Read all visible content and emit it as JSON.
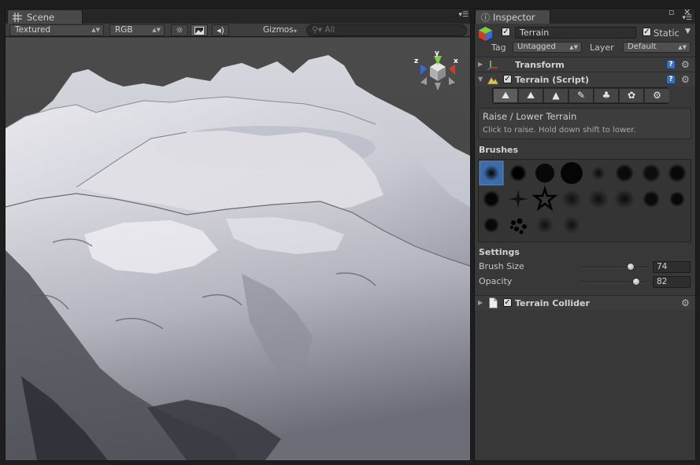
{
  "scene": {
    "tab_label": "Scene",
    "render_mode": "Textured",
    "color_mode": "RGB",
    "lighting_icon": "sun-icon",
    "image_icon": "image-icon",
    "audio_icon": "speaker-icon",
    "gizmos_label": "Gizmos",
    "search_placeholder": "All",
    "axis_labels": {
      "y": "y",
      "x": "x",
      "z": "z"
    }
  },
  "inspector": {
    "tab_label": "Inspector",
    "object_name": "Terrain",
    "active_checked": true,
    "static_label": "Static",
    "static_checked": true,
    "tag_label": "Tag",
    "tag_value": "Untagged",
    "layer_label": "Layer",
    "layer_value": "Default",
    "components": {
      "transform": {
        "label": "Transform"
      },
      "terrain": {
        "label": "Terrain (Script)",
        "enabled": true
      },
      "collider": {
        "label": "Terrain Collider",
        "enabled": true
      }
    },
    "tools": [
      "raise-lower-icon",
      "paint-height-icon",
      "smooth-height-icon",
      "paint-texture-icon",
      "place-trees-icon",
      "paint-details-icon",
      "settings-icon"
    ],
    "active_tool": 0,
    "tool_title": "Raise / Lower Terrain",
    "tool_description": "Click to raise. Hold down shift to lower.",
    "brushes_label": "Brushes",
    "selected_brush": 0,
    "settings_label": "Settings",
    "brush_size_label": "Brush Size",
    "brush_size_value": "74",
    "brush_size_fraction": 0.74,
    "opacity_label": "Opacity",
    "opacity_value": "82",
    "opacity_fraction": 0.82
  },
  "colors": {
    "selection_blue": "#3e6ba6",
    "axis_y": "#7ccf3a",
    "axis_x": "#d43a2a",
    "axis_z": "#3a6ad4"
  }
}
